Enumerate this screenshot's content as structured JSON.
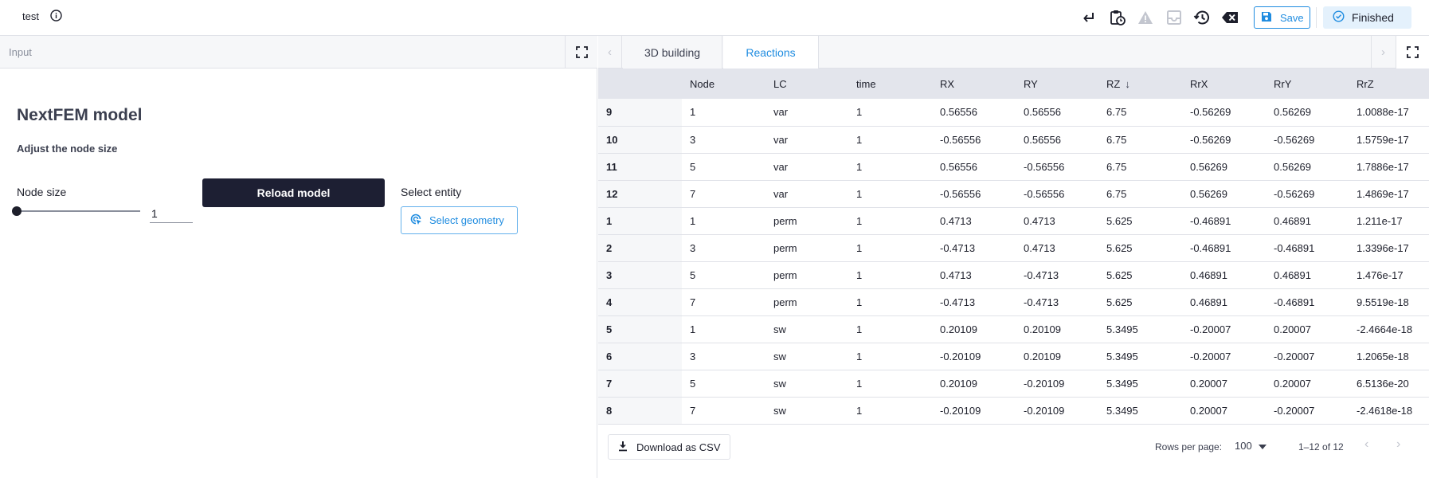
{
  "app": {
    "title": "test"
  },
  "toolbar": {
    "icons": [
      "return-icon",
      "clipboard-clock-icon",
      "warning-icon",
      "inbox-icon",
      "history-icon",
      "clear-icon"
    ],
    "save_label": "Save",
    "status_label": "Finished"
  },
  "left_panel": {
    "header": "Input",
    "title": "NextFEM model",
    "subtitle": "Adjust the node size",
    "node_size_label": "Node size",
    "node_size_value": "1",
    "node_size_slider_fraction": 0.0,
    "reload_label": "Reload model",
    "select_entity_label": "Select entity",
    "select_geometry_label": "Select geometry"
  },
  "right_panel": {
    "tabs": [
      {
        "label": "3D building",
        "active": false
      },
      {
        "label": "Reactions",
        "active": true
      }
    ],
    "table": {
      "columns": [
        "",
        "Node",
        "LC",
        "time",
        "RX",
        "RY",
        "RZ",
        "RrX",
        "RrY",
        "RrZ"
      ],
      "sorted_column": "RZ",
      "sort_direction": "descending",
      "rows": [
        [
          "9",
          "1",
          "var",
          "1",
          "0.56556",
          "0.56556",
          "6.75",
          "-0.56269",
          "0.56269",
          "1.0088e-17"
        ],
        [
          "10",
          "3",
          "var",
          "1",
          "-0.56556",
          "0.56556",
          "6.75",
          "-0.56269",
          "-0.56269",
          "1.5759e-17"
        ],
        [
          "11",
          "5",
          "var",
          "1",
          "0.56556",
          "-0.56556",
          "6.75",
          "0.56269",
          "0.56269",
          "1.7886e-17"
        ],
        [
          "12",
          "7",
          "var",
          "1",
          "-0.56556",
          "-0.56556",
          "6.75",
          "0.56269",
          "-0.56269",
          "1.4869e-17"
        ],
        [
          "1",
          "1",
          "perm",
          "1",
          "0.4713",
          "0.4713",
          "5.625",
          "-0.46891",
          "0.46891",
          "1.211e-17"
        ],
        [
          "2",
          "3",
          "perm",
          "1",
          "-0.4713",
          "0.4713",
          "5.625",
          "-0.46891",
          "-0.46891",
          "1.3396e-17"
        ],
        [
          "3",
          "5",
          "perm",
          "1",
          "0.4713",
          "-0.4713",
          "5.625",
          "0.46891",
          "0.46891",
          "1.476e-17"
        ],
        [
          "4",
          "7",
          "perm",
          "1",
          "-0.4713",
          "-0.4713",
          "5.625",
          "0.46891",
          "-0.46891",
          "9.5519e-18"
        ],
        [
          "5",
          "1",
          "sw",
          "1",
          "0.20109",
          "0.20109",
          "5.3495",
          "-0.20007",
          "0.20007",
          "-2.4664e-18"
        ],
        [
          "6",
          "3",
          "sw",
          "1",
          "-0.20109",
          "0.20109",
          "5.3495",
          "-0.20007",
          "-0.20007",
          "1.2065e-18"
        ],
        [
          "7",
          "5",
          "sw",
          "1",
          "0.20109",
          "-0.20109",
          "5.3495",
          "0.20007",
          "0.20007",
          "6.5136e-20"
        ],
        [
          "8",
          "7",
          "sw",
          "1",
          "-0.20109",
          "-0.20109",
          "5.3495",
          "0.20007",
          "-0.20007",
          "-2.4618e-18"
        ]
      ]
    },
    "footer": {
      "download_label": "Download as CSV",
      "rows_per_page_label": "Rows per page:",
      "rows_per_page_value": "100",
      "page_range": "1–12 of 12"
    }
  },
  "colors": {
    "accent": "#1f8ce0",
    "dark_button": "#1d1f33",
    "header_bg": "#e3e5ec",
    "status_bg": "#e4f1fc"
  }
}
